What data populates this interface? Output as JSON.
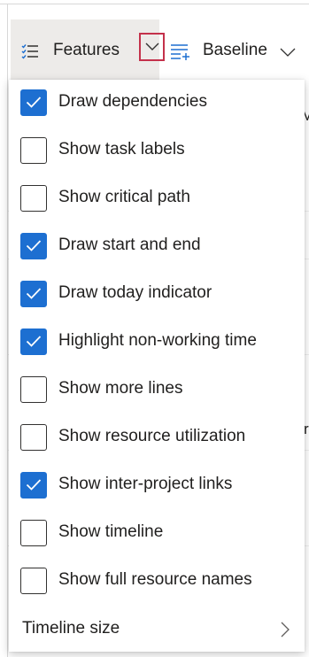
{
  "toolbar": {
    "features_label": "Features",
    "baseline_label": "Baseline"
  },
  "background_fragments": {
    "fragment_a": "M",
    "fragment_b": "r"
  },
  "menu": {
    "items": [
      {
        "label": "Draw dependencies",
        "checked": true
      },
      {
        "label": "Show task labels",
        "checked": false
      },
      {
        "label": "Show critical path",
        "checked": false
      },
      {
        "label": "Draw start and end",
        "checked": true
      },
      {
        "label": "Draw today indicator",
        "checked": true
      },
      {
        "label": "Highlight non-working time",
        "checked": true
      },
      {
        "label": "Show more lines",
        "checked": false
      },
      {
        "label": "Show resource utilization",
        "checked": false
      },
      {
        "label": "Show inter-project links",
        "checked": true
      },
      {
        "label": "Show timeline",
        "checked": false
      },
      {
        "label": "Show full resource names",
        "checked": false
      }
    ],
    "submenu_label": "Timeline size"
  },
  "colors": {
    "accent": "#1d6fd1",
    "focus_border": "#c4314b",
    "hover_bg": "#edebe9"
  },
  "icons": {
    "features": "features-list-icon",
    "baseline": "baseline-icon",
    "dropdown": "chevron-down-icon",
    "submenu": "chevron-right-icon",
    "check": "checkmark-icon"
  }
}
